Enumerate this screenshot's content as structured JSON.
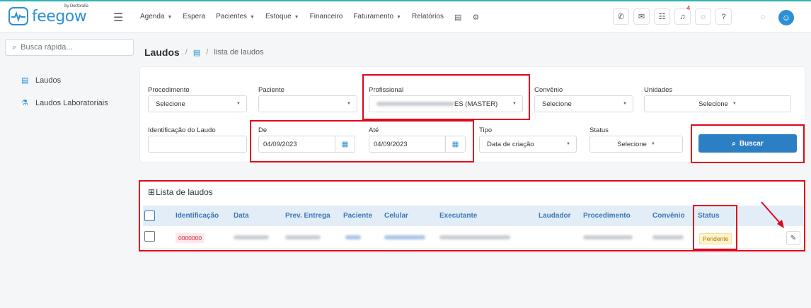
{
  "app": {
    "logo_text": "feegow",
    "logo_sub": "by Doctoralia"
  },
  "nav": {
    "items": [
      {
        "label": "Agenda",
        "caret": true
      },
      {
        "label": "Espera",
        "caret": false
      },
      {
        "label": "Pacientes",
        "caret": true
      },
      {
        "label": "Estoque",
        "caret": true
      },
      {
        "label": "Financeiro",
        "caret": false
      },
      {
        "label": "Faturamento",
        "caret": true
      },
      {
        "label": "Relatórios",
        "caret": false
      }
    ],
    "extra_icons": [
      "database-icon",
      "gear-icon"
    ]
  },
  "top_icons": {
    "phone": "phone-icon",
    "inbox": "inbox-icon",
    "list": "list-icon",
    "bell": "bell-icon",
    "bell_badge": "4",
    "chat": "chat-icon",
    "help": "help-icon",
    "user": "user-icon"
  },
  "search": {
    "placeholder": "Busca rápida..."
  },
  "sidebar": {
    "items": [
      {
        "label": "Laudos",
        "icon": "document-icon"
      },
      {
        "label": "Laudos Laboratoriais",
        "icon": "flask-icon"
      }
    ]
  },
  "breadcrumb": {
    "title": "Laudos",
    "separator": "/",
    "sub": "lista de laudos"
  },
  "filters": {
    "procedimento": {
      "label": "Procedimento",
      "value": "Selecione"
    },
    "paciente": {
      "label": "Paciente",
      "value": ""
    },
    "profissional": {
      "label": "Profissional",
      "value": "ES (MASTER)"
    },
    "convenio": {
      "label": "Convênio",
      "value": "Selecione"
    },
    "unidades": {
      "label": "Unidades",
      "value": "Selecione"
    },
    "identificacao": {
      "label": "Identificação do Laudo",
      "value": ""
    },
    "de": {
      "label": "De",
      "value": "04/09/2023"
    },
    "ate": {
      "label": "Até",
      "value": "04/09/2023"
    },
    "tipo": {
      "label": "Tipo",
      "value": "Data de criação"
    },
    "status": {
      "label": "Status",
      "value": "Selecione"
    },
    "buscar_label": "Buscar"
  },
  "list": {
    "title": "Lista de laudos",
    "columns": [
      "Identificação",
      "Data",
      "Prev. Entrega",
      "Paciente",
      "Celular",
      "Executante",
      "Laudador",
      "Procedimento",
      "Convênio",
      "Status"
    ],
    "rows": [
      {
        "identificacao": "0000000",
        "status": "Pendente"
      }
    ]
  },
  "highlight_color": "#e0061a",
  "brand_color": "#2d8fd5"
}
